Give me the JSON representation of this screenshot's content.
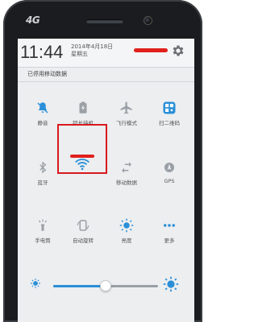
{
  "device": {
    "carrier_logo": "4G"
  },
  "header": {
    "time": "11:44",
    "date": "2014年4月18日",
    "weekday": "星期五",
    "settings_icon": "gear-icon"
  },
  "notice": {
    "text": "已停用移动数据"
  },
  "tiles": [
    {
      "label": "静音",
      "icon": "mute-icon",
      "active": true
    },
    {
      "label": "超长待机",
      "icon": "battery-saver-icon",
      "active": false
    },
    {
      "label": "飞行模式",
      "icon": "airplane-icon",
      "active": false
    },
    {
      "label": "扫二维码",
      "icon": "qr-scan-icon",
      "active": true
    },
    {
      "label": "蓝牙",
      "icon": "bluetooth-icon",
      "active": false
    },
    {
      "label": "",
      "icon": "wifi-icon",
      "active": true
    },
    {
      "label": "移动数据",
      "icon": "mobile-data-icon",
      "active": false
    },
    {
      "label": "GPS",
      "icon": "gps-icon",
      "active": false
    },
    {
      "label": "手电筒",
      "icon": "flashlight-icon",
      "active": false
    },
    {
      "label": "自动旋转",
      "icon": "auto-rotate-icon",
      "active": false
    },
    {
      "label": "亮度",
      "icon": "brightness-icon",
      "active": true
    },
    {
      "label": "更多",
      "icon": "more-icon",
      "active": true
    }
  ],
  "brightness": {
    "level": 0.5
  },
  "colors": {
    "accent": "#2a8fd8",
    "inactive": "#9aa0a6",
    "highlight": "#d9181e"
  }
}
